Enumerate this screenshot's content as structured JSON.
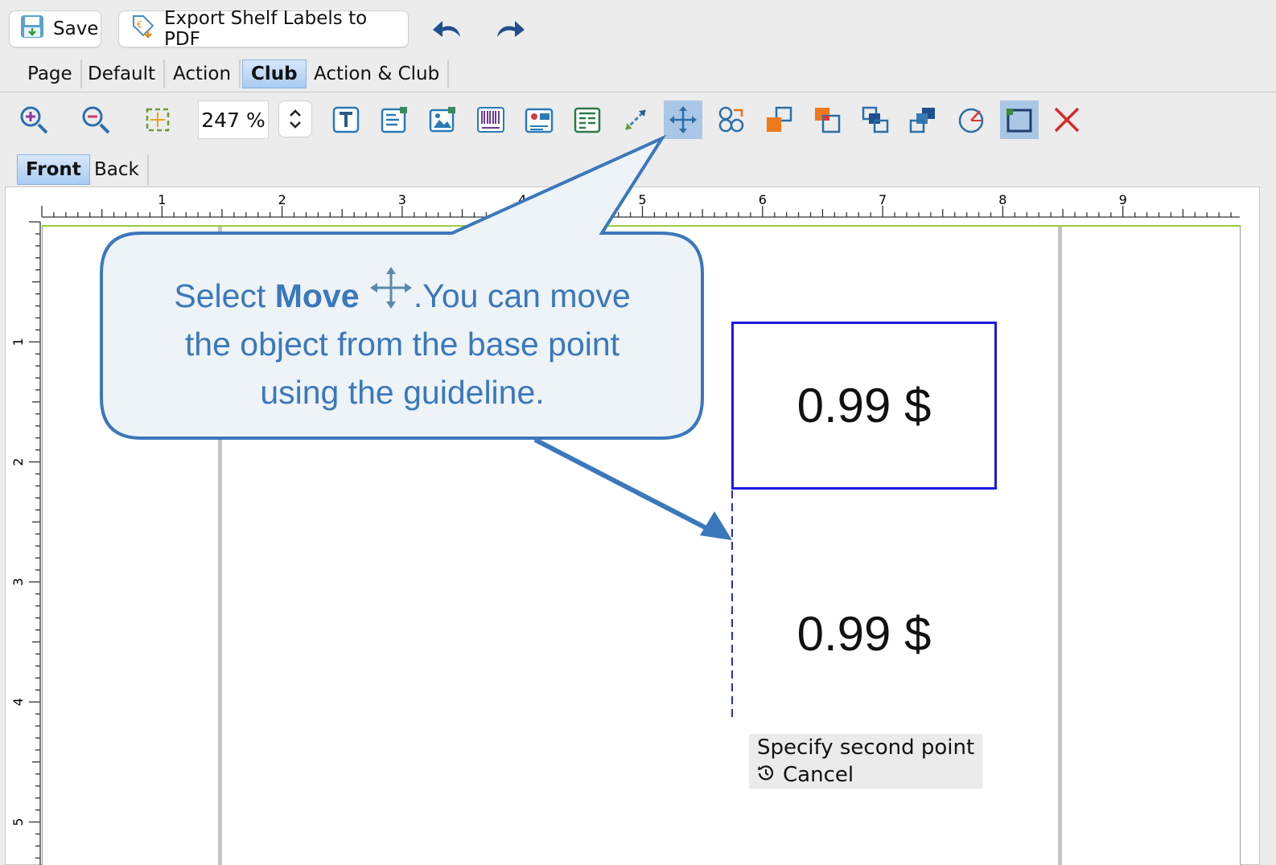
{
  "toolbar": {
    "save_label": "Save",
    "export_label": "Export Shelf Labels to PDF",
    "undo_icon": "undo-arrow-icon",
    "redo_icon": "redo-arrow-icon"
  },
  "tabs": [
    {
      "label": "Page",
      "active": false
    },
    {
      "label": "Default",
      "active": false
    },
    {
      "label": "Action",
      "active": false
    },
    {
      "label": "Club",
      "active": true
    },
    {
      "label": "Action & Club",
      "active": false
    }
  ],
  "zoom": {
    "value": "247 %"
  },
  "tools": [
    "zoom-in-icon",
    "zoom-out-icon",
    "fit-page-icon",
    "text-tool-icon",
    "field-tool-icon",
    "image-tool-icon",
    "barcode-tool-icon",
    "map-tool-icon",
    "table-tool-icon",
    "line-tool-icon",
    "move-tool-icon",
    "group-icon",
    "bring-forward-icon",
    "send-backward-icon",
    "bring-to-front-icon",
    "send-to-back-icon",
    "rotate-icon",
    "frame-icon",
    "delete-icon"
  ],
  "side": {
    "front": "Front",
    "back": "Back"
  },
  "ruler": {
    "top": [
      "1",
      "2",
      "3",
      "4",
      "5",
      "6",
      "7",
      "8",
      "9"
    ],
    "left": [
      "1",
      "2",
      "3",
      "4",
      "5"
    ]
  },
  "canvas": {
    "price": "0.99 $",
    "price_ghost": "0.99 $",
    "prompt_title": "Specify second point",
    "prompt_cancel": "Cancel"
  },
  "callout": {
    "text_pre": "Select ",
    "text_bold": "Move",
    "text_post": ".You can move",
    "line2": "the object from the base point",
    "line3": "using the guideline."
  },
  "colors": {
    "accent": "#3a78bb",
    "selection_box": "#1a1adf",
    "callout_fill": "#eef3f8"
  }
}
